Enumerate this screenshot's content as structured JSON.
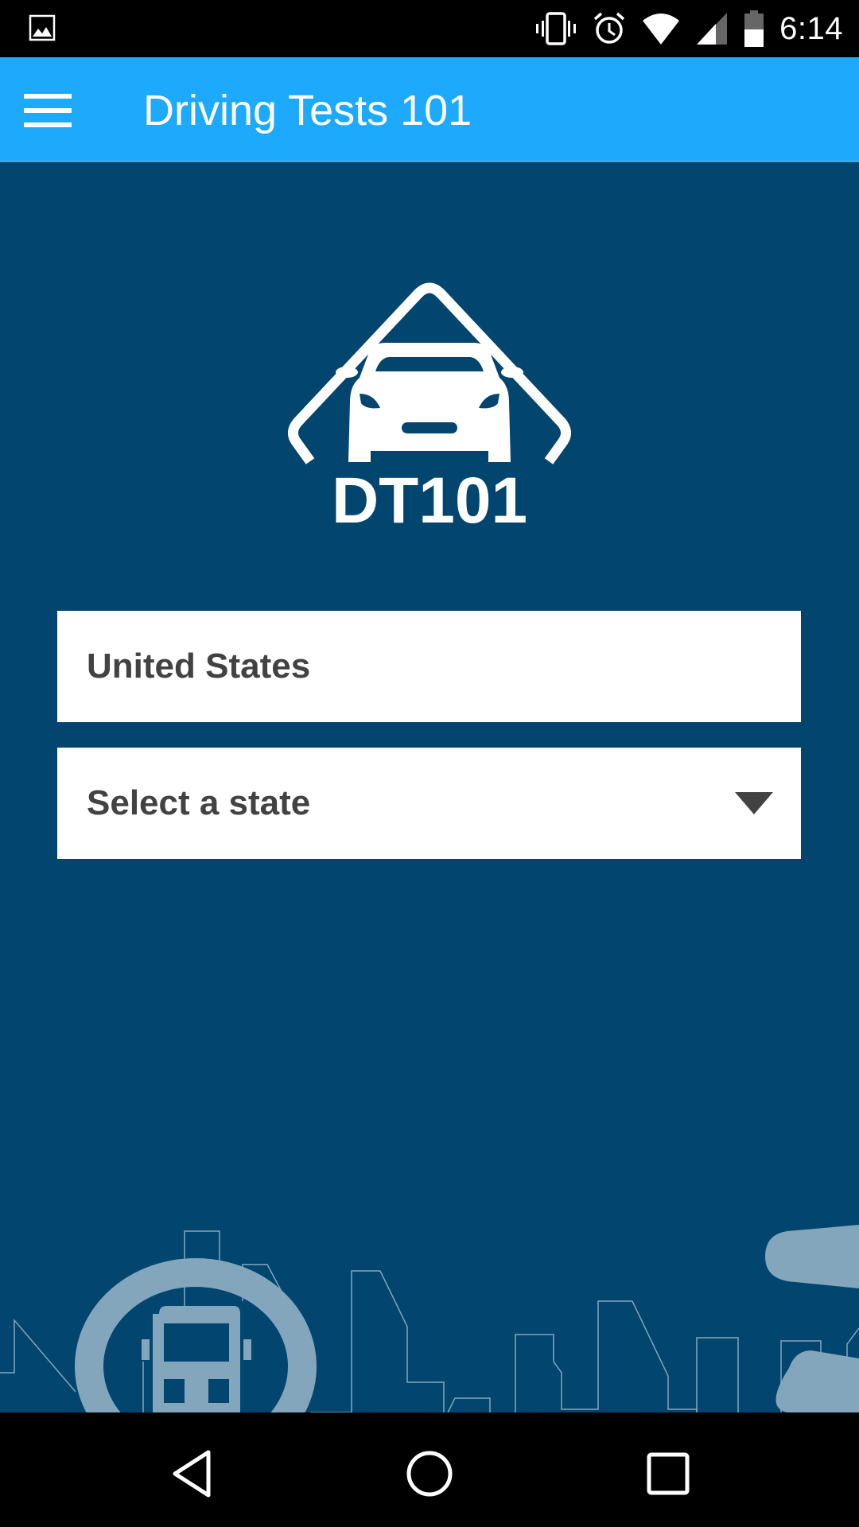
{
  "status_bar": {
    "time": "6:14",
    "icons": [
      "image-notification-icon",
      "vibrate-icon",
      "alarm-icon",
      "wifi-icon",
      "cell-signal-icon",
      "battery-icon"
    ]
  },
  "app_bar": {
    "title": "Driving Tests 101",
    "menu_icon": "hamburger-menu-icon"
  },
  "logo": {
    "text": "DT101",
    "icon": "car-in-diamond-sign-icon"
  },
  "form": {
    "country_value": "United States",
    "state_placeholder": "Select a state"
  },
  "colors": {
    "app_bar": "#1da9fc",
    "background": "#02456e",
    "field_text": "#424242",
    "illustration": "#83a6bd"
  },
  "nav_bar": {
    "buttons": [
      "back-icon",
      "home-icon",
      "recents-icon"
    ]
  }
}
